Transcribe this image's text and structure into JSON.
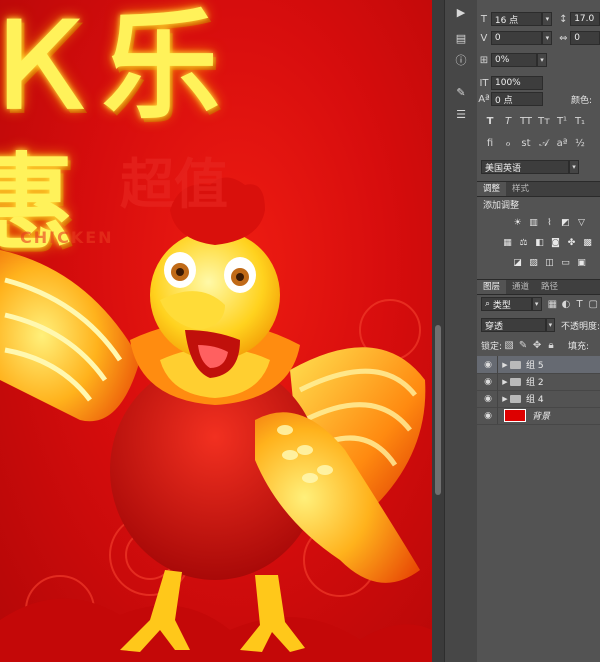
{
  "canvas": {
    "background_color": "#d70d0d",
    "artwork_text": {
      "top": "Ｋ乐",
      "middle": "惠",
      "faded": "超值",
      "english": "CHICKEN"
    }
  },
  "character_panel": {
    "font_size": {
      "icon": "font-size-icon",
      "value": "16 点"
    },
    "leading": {
      "icon": "leading-icon",
      "value": "17.0"
    },
    "kerning": {
      "icon": "kerning-icon",
      "value": "0"
    },
    "tracking": {
      "icon": "tracking-icon",
      "value": "0"
    },
    "tsume": {
      "value": "0%"
    },
    "vertical_scale": {
      "value": "100%"
    },
    "baseline_shift": {
      "value": "0 点"
    },
    "color_label": "颜色:",
    "language": "美国英语"
  },
  "adjustments_panel": {
    "tabs": [
      "调整",
      "样式"
    ],
    "title": "添加调整"
  },
  "layers_panel": {
    "tabs": [
      "图层",
      "通道",
      "路径"
    ],
    "filter_kind": "类型",
    "blend_mode": "穿透",
    "opacity_label": "不透明度:",
    "lock_label": "锁定:",
    "fill_label": "填充:",
    "layers": [
      {
        "name": "组 5",
        "type": "group",
        "selected": true
      },
      {
        "name": "组 2",
        "type": "group",
        "selected": false
      },
      {
        "name": "组 4",
        "type": "group",
        "selected": false
      },
      {
        "name": "背景",
        "type": "background",
        "selected": false
      }
    ]
  }
}
